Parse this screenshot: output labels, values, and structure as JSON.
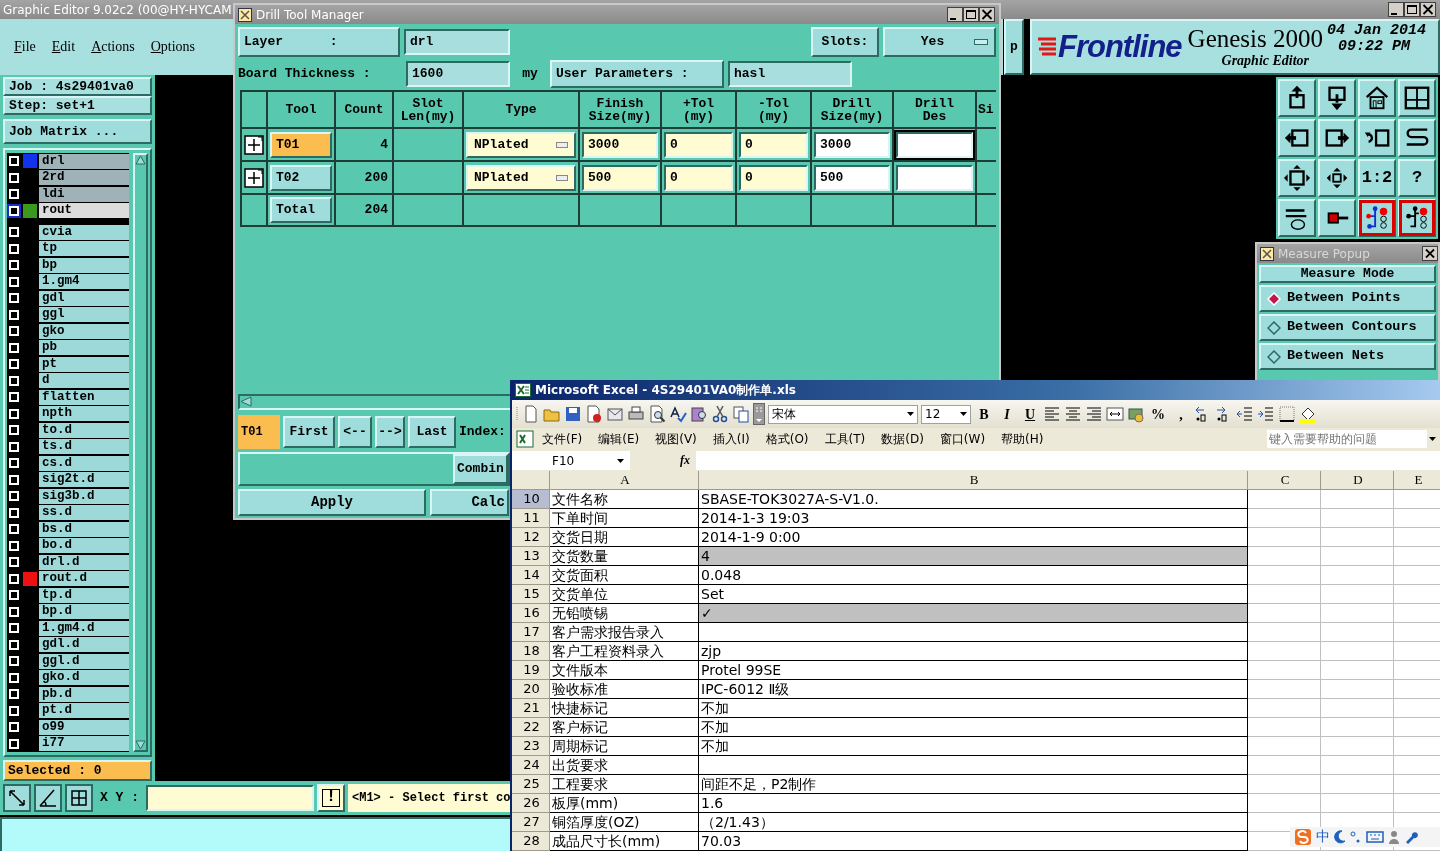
{
  "main_window": {
    "title": "Graphic Editor 9.02c2 (00@HY-HYCAM",
    "menu": [
      "File",
      "Edit",
      "Actions",
      "Options"
    ],
    "cut_button": "p",
    "header": {
      "logo": "Frontline",
      "product": "Genesis 2000",
      "subtitle": "Graphic Editor",
      "date": "04 Jan 2014",
      "time": "09:22 PM"
    },
    "tool_buttons": [
      {
        "kind": "icon",
        "active": false
      },
      {
        "kind": "icon",
        "active": false
      },
      {
        "kind": "icon",
        "active": false
      },
      {
        "kind": "icon",
        "active": false
      },
      {
        "kind": "icon",
        "active": false
      },
      {
        "kind": "icon",
        "active": false
      },
      {
        "kind": "icon",
        "active": false
      },
      {
        "kind": "icon",
        "active": false
      },
      {
        "kind": "icon",
        "active": false
      },
      {
        "kind": "icon",
        "active": false
      },
      {
        "kind": "text",
        "text": "1:2",
        "active": false
      },
      {
        "kind": "text",
        "text": "?",
        "active": false
      },
      {
        "kind": "icon",
        "active": false
      },
      {
        "kind": "icon",
        "active": false
      },
      {
        "kind": "icon",
        "active": true
      },
      {
        "kind": "icon",
        "active": true
      }
    ],
    "job": "Job : 4s29401va0",
    "step": "Step: set+1",
    "job_matrix_button": "Job Matrix ...",
    "layers": [
      {
        "name": "drl",
        "kind": "board",
        "color": "#1133ee",
        "selected": false
      },
      {
        "name": "2rd",
        "kind": "board",
        "selected": false
      },
      {
        "name": "ldi",
        "kind": "board",
        "selected": false
      },
      {
        "name": "rout",
        "kind": "board",
        "color": "#3a9a1e",
        "selected": true
      },
      {
        "name": "cvia",
        "kind": "misc",
        "selected": false
      },
      {
        "name": "tp",
        "kind": "misc",
        "selected": false
      },
      {
        "name": "bp",
        "kind": "misc",
        "selected": false
      },
      {
        "name": "1.gm4",
        "kind": "misc",
        "selected": false
      },
      {
        "name": "gdl",
        "kind": "misc",
        "selected": false
      },
      {
        "name": "ggl",
        "kind": "misc",
        "selected": false
      },
      {
        "name": "gko",
        "kind": "misc",
        "selected": false
      },
      {
        "name": "pb",
        "kind": "misc",
        "selected": false
      },
      {
        "name": "pt",
        "kind": "misc",
        "selected": false
      },
      {
        "name": "d",
        "kind": "misc",
        "selected": false
      },
      {
        "name": "flatten",
        "kind": "misc",
        "selected": false
      },
      {
        "name": "npth",
        "kind": "misc",
        "selected": false
      },
      {
        "name": "to.d",
        "kind": "misc",
        "selected": false
      },
      {
        "name": "ts.d",
        "kind": "misc",
        "selected": false
      },
      {
        "name": "cs.d",
        "kind": "misc",
        "selected": false
      },
      {
        "name": "sig2t.d",
        "kind": "misc",
        "selected": false
      },
      {
        "name": "sig3b.d",
        "kind": "misc",
        "selected": false
      },
      {
        "name": "ss.d",
        "kind": "misc",
        "selected": false
      },
      {
        "name": "bs.d",
        "kind": "misc",
        "selected": false
      },
      {
        "name": "bo.d",
        "kind": "misc",
        "selected": false
      },
      {
        "name": "drl.d",
        "kind": "misc",
        "selected": false
      },
      {
        "name": "rout.d",
        "kind": "misc",
        "color": "#ee1111",
        "selected": false
      },
      {
        "name": "tp.d",
        "kind": "misc",
        "selected": false
      },
      {
        "name": "bp.d",
        "kind": "misc",
        "selected": false
      },
      {
        "name": "1.gm4.d",
        "kind": "misc",
        "selected": false
      },
      {
        "name": "gdl.d",
        "kind": "misc",
        "selected": false
      },
      {
        "name": "ggl.d",
        "kind": "misc",
        "selected": false
      },
      {
        "name": "gko.d",
        "kind": "misc",
        "selected": false
      },
      {
        "name": "pb.d",
        "kind": "misc",
        "selected": false
      },
      {
        "name": "pt.d",
        "kind": "misc",
        "selected": false
      },
      {
        "name": "o99",
        "kind": "misc",
        "selected": false
      },
      {
        "name": "i77",
        "kind": "misc",
        "selected": false
      }
    ],
    "selected_count": "Selected : 0",
    "xy_label": "X Y :",
    "alert_button": "!",
    "message": "<M1> - Select first co"
  },
  "drill_tool_manager": {
    "title": "Drill Tool Manager",
    "layer_label": "Layer      :",
    "layer": "drl",
    "slots_label": "Slots:",
    "slots": "Yes",
    "thickness_label": "Board Thickness :",
    "thickness": "1600",
    "thickness_unit": "my",
    "user_params_label": "User Parameters :",
    "user_params": "hasl",
    "columns": [
      "Tool",
      "Count",
      "Slot Len(my)",
      "Type",
      "Finish Size(my)",
      "+Tol (my)",
      "-Tol (my)",
      "Drill Size(my)",
      "Drill Des",
      "Si"
    ],
    "rows": [
      {
        "tool": "T01",
        "count": "4",
        "type": "NPlated",
        "finish_size": "3000",
        "plus_tol": "0",
        "minus_tol": "0",
        "drill_size": "3000",
        "selected": true
      },
      {
        "tool": "T02",
        "count": "200",
        "type": "NPlated",
        "finish_size": "500",
        "plus_tol": "0",
        "minus_tol": "0",
        "drill_size": "500",
        "selected": false
      }
    ],
    "total": {
      "label": "Total",
      "count": "204"
    },
    "current_tool": "T01",
    "nav_buttons": [
      "First",
      "<--",
      "-->",
      "Last"
    ],
    "index_label": "Index:",
    "combine_button": "Combin",
    "apply_button": "Apply",
    "calc_button": "Calc"
  },
  "measure_popup": {
    "title": "Measure Popup",
    "header": "Measure Mode",
    "options": [
      {
        "label": "Between Points",
        "selected": true
      },
      {
        "label": "Between Contours",
        "selected": false
      },
      {
        "label": "Between Nets",
        "selected": false
      }
    ]
  },
  "excel": {
    "title": "Microsoft Excel - 4S29401VA0制作单.xls",
    "font": "宋体",
    "font_size": "12",
    "format_buttons": [
      "B",
      "I",
      "U"
    ],
    "number_buttons": [
      "%",
      ","
    ],
    "menu": [
      "文件(F)",
      "编辑(E)",
      "视图(V)",
      "插入(I)",
      "格式(O)",
      "工具(T)",
      "数据(D)",
      "窗口(W)",
      "帮助(H)"
    ],
    "help_placeholder": "键入需要帮助的问题",
    "name_box": "F10",
    "formula_label": "fx",
    "columns": [
      "A",
      "B",
      "C",
      "D",
      "E"
    ],
    "rows": [
      {
        "number": "10",
        "label": "文件名称",
        "value": "SBASE-TOK3027A-S-V1.0.",
        "selected": true,
        "shaded": false
      },
      {
        "number": "11",
        "label": "下单时间",
        "value": "2014-1-3 19:03",
        "selected": false,
        "shaded": false
      },
      {
        "number": "12",
        "label": "交货日期",
        "value": "2014-1-9 0:00",
        "selected": false,
        "shaded": false
      },
      {
        "number": "13",
        "label": "交货数量",
        "value": "4",
        "selected": false,
        "shaded": true
      },
      {
        "number": "14",
        "label": "交货面积",
        "value": "0.048",
        "selected": false,
        "shaded": false
      },
      {
        "number": "15",
        "label": "交货单位",
        "value": "Set",
        "selected": false,
        "shaded": false
      },
      {
        "number": "16",
        "label": "无铅喷锡",
        "value": "✓",
        "selected": false,
        "shaded": true
      },
      {
        "number": "17",
        "label": "客户需求报告录入",
        "selected": false,
        "shaded": false
      },
      {
        "number": "18",
        "label": "客户工程资料录入",
        "value": "zjp",
        "selected": false,
        "shaded": false
      },
      {
        "number": "19",
        "label": "文件版本",
        "value": "Protel 99SE",
        "selected": false,
        "shaded": false
      },
      {
        "number": "20",
        "label": "验收标准",
        "value": "IPC-6012 Ⅱ级",
        "selected": false,
        "shaded": false
      },
      {
        "number": "21",
        "label": "快捷标记",
        "value": "不加",
        "selected": false,
        "shaded": false
      },
      {
        "number": "22",
        "label": "客户标记",
        "value": "不加",
        "selected": false,
        "shaded": false
      },
      {
        "number": "23",
        "label": "周期标记",
        "value": "不加",
        "selected": false,
        "shaded": false
      },
      {
        "number": "24",
        "label": "出货要求",
        "selected": false,
        "shaded": false
      },
      {
        "number": "25",
        "label": "工程要求",
        "value": "间距不足，P2制作",
        "selected": false,
        "shaded": false
      },
      {
        "number": "26",
        "label": "板厚(mm)",
        "value": "1.6",
        "selected": false,
        "shaded": false
      },
      {
        "number": "27",
        "label": "铜箔厚度(OZ)",
        "value": "（2/1.43）",
        "selected": false,
        "shaded": false
      },
      {
        "number": "28",
        "label": "成品尺寸长(mm)",
        "value": "70.03",
        "selected": false,
        "shaded": false
      }
    ]
  },
  "ime_bar": {
    "mode": "中"
  }
}
